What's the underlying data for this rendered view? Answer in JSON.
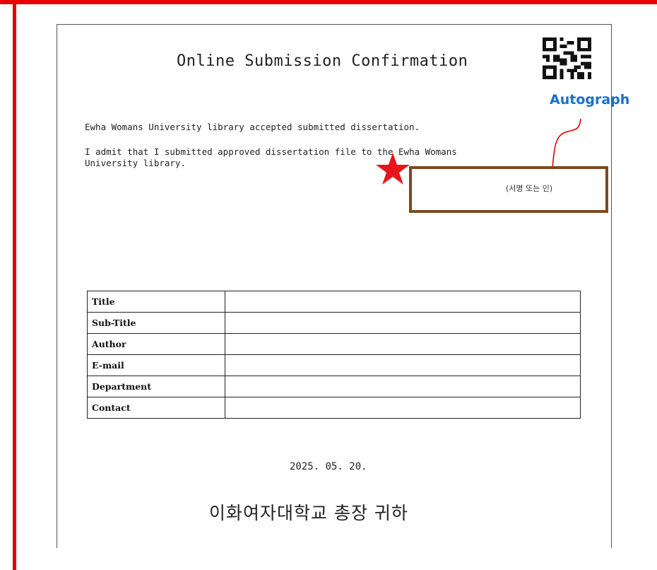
{
  "document": {
    "title": "Online Submission Confirmation",
    "statement_1": "Ewha Womans University library accepted submitted dissertation.",
    "statement_2_line1": "I admit that I submitted approved dissertation file to the Ewha Womans",
    "statement_2_line2": "University library.",
    "signature_hint": "(서명 또는 인)",
    "fields": [
      {
        "label": "Title",
        "value": ""
      },
      {
        "label": "Sub-Title",
        "value": ""
      },
      {
        "label": "Author",
        "value": ""
      },
      {
        "label": "E-mail",
        "value": ""
      },
      {
        "label": "Department",
        "value": ""
      },
      {
        "label": "Contact",
        "value": ""
      }
    ],
    "date": "2025. 05. 20.",
    "addressee": "이화여자대학교 총장 귀하"
  },
  "annotation": {
    "autograph_label": "Autograph",
    "label_color": "#1a6fc8",
    "box_color": "#7b4a1f",
    "star_color": "#e8141b",
    "frame_color": "#e60000"
  },
  "icons": [
    "qr-code-icon",
    "star-icon"
  ]
}
